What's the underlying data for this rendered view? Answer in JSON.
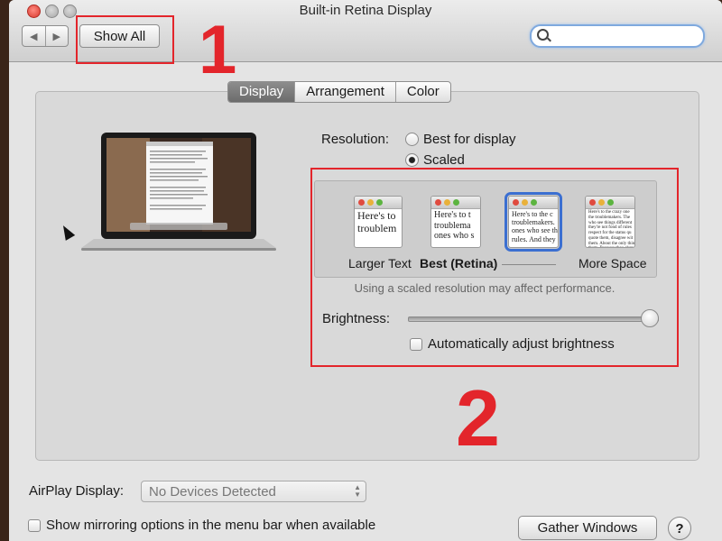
{
  "window": {
    "title": "Built-in Retina Display"
  },
  "toolbar": {
    "back_icon": "◀",
    "forward_icon": "▶",
    "show_all_label": "Show All",
    "search_placeholder": ""
  },
  "tabs": [
    {
      "label": "Display",
      "active": true
    },
    {
      "label": "Arrangement",
      "active": false
    },
    {
      "label": "Color",
      "active": false
    }
  ],
  "resolution": {
    "label": "Resolution:",
    "options": [
      {
        "label": "Best for display",
        "selected": false
      },
      {
        "label": "Scaled",
        "selected": true
      }
    ]
  },
  "scaled_options": [
    {
      "caption": "Larger Text",
      "preview": "Here's to\ntroublem",
      "selected": false
    },
    {
      "caption": "Best (Retina)",
      "preview": "Here's to t\ntroublema\nones who s",
      "selected": false
    },
    {
      "caption": "",
      "preview": "Here's to the c\ntroublemakers.\nones who see th\nrules. And they",
      "selected": true
    },
    {
      "caption": "More Space",
      "preview": "Here's to the crazy one\nthe troublemakers. The\nwho see things different\nthey're not fond of rules\nrespect for the status qu\nquote them, disagree wit\nthem. About the only thin\nthem. Because they chan\npush the human race forw",
      "selected": false
    }
  ],
  "scaled_note": "Using a scaled resolution may affect performance.",
  "brightness": {
    "label": "Brightness:",
    "level": 1.0,
    "auto_label": "Automatically adjust brightness",
    "auto_checked": false
  },
  "airplay": {
    "label": "AirPlay Display:",
    "value": "No Devices Detected"
  },
  "mirroring": {
    "label": "Show mirroring options in the menu bar when available",
    "checked": false
  },
  "gather_windows_label": "Gather Windows",
  "help_label": "?",
  "annotations": {
    "marker_1": "1",
    "marker_2": "2",
    "color": "#e3252b"
  }
}
